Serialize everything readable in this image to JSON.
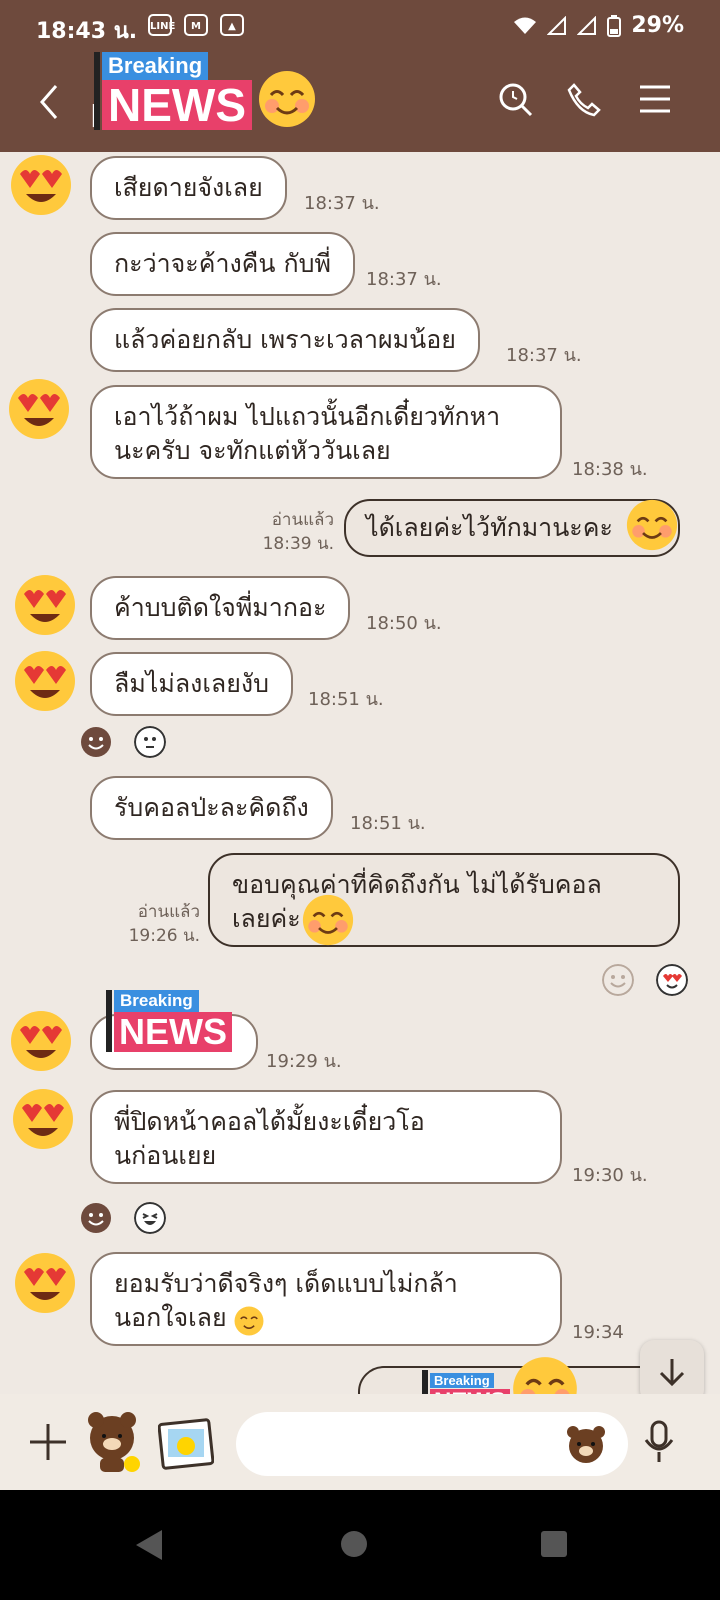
{
  "status": {
    "time": "18:43 น.",
    "battery": "29%"
  },
  "header": {
    "title_initial": "l",
    "news_top": "Breaking",
    "news_bottom": "NEWS"
  },
  "messages": [
    {
      "text": "เสียดายจังเลย",
      "time": "18:37 น."
    },
    {
      "text": "กะว่าจะค้างคืน กับพี่",
      "time": "18:37 น."
    },
    {
      "text": "แล้วค่อยกลับ เพราะเวลาผมน้อย",
      "time": "18:37 น."
    },
    {
      "line1": "เอาไว้ถ้าผม ไปแถวนั้นอีกเดี๋ยวทักหา",
      "line2": "นะครับ จะทักแต่หัววันเลย",
      "time": "18:38 น."
    },
    {
      "text": "ได้เลยค่ะไว้ทักมานะคะ",
      "read": "อ่านแล้ว",
      "time": "18:39 น."
    },
    {
      "text": "ค้าบบติดใจพี่มากอะ",
      "time": "18:50 น."
    },
    {
      "text": "ลืมไม่ลงเลยงับ",
      "time": "18:51 น."
    },
    {
      "text": "รับคอลป่ะละคิดถึง",
      "time": "18:51 น."
    },
    {
      "line1": "ขอบคุณค่าที่คิดถึงกัน ไม่ได้รับคอล",
      "line2": "เลยค่ะ",
      "read": "อ่านแล้ว",
      "time": "19:26 น."
    },
    {
      "news_top": "Breaking",
      "news_bottom": "NEWS",
      "time": "19:29 น."
    },
    {
      "line1": "พี่ปิดหน้าคอลได้มั้ยงะเดี๋ยวโอ",
      "line2": "นก่อนเยย",
      "time": "19:30 น."
    },
    {
      "line1": "ยอมรับว่าดีจริงๆ เด็ดแบบไม่กล้า",
      "line2": "นอกใจเลย",
      "time": "19:34"
    },
    {
      "news_top": "Breaking",
      "news_bottom": "NEWS"
    }
  ],
  "colors": {
    "header": "#6e4a3d",
    "chat_bg": "#efe9e3",
    "incoming": "#ffffff",
    "outgoing": "#ede6df"
  },
  "icons": [
    "back-icon",
    "search-icon",
    "phone-icon",
    "menu-icon",
    "add-icon",
    "sticker-icon",
    "photo-icon",
    "mic-icon",
    "scroll-down-icon"
  ]
}
